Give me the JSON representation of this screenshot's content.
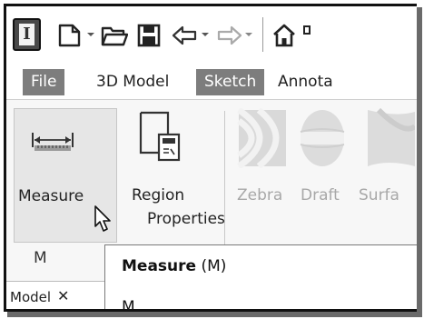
{
  "toolbar": {
    "app_letter": "I",
    "icons": [
      "new-file-icon",
      "dropdown-icon",
      "open-folder-icon",
      "save-icon",
      "undo-icon",
      "dropdown-icon",
      "redo-icon",
      "dropdown-icon",
      "home-icon"
    ]
  },
  "tabs": [
    {
      "label": "File",
      "active": true
    },
    {
      "label": "3D Model",
      "active": false
    },
    {
      "label": "Sketch",
      "active": true
    },
    {
      "label": "Annota",
      "active": false
    }
  ],
  "ribbon": {
    "measure": {
      "label": "Measure"
    },
    "region_properties": {
      "line1": "Region",
      "line2": "Properties"
    },
    "zebra": {
      "label": "Zebra"
    },
    "draft": {
      "label": "Draft"
    },
    "surface": {
      "label": "Surfa"
    },
    "panel_title": "M"
  },
  "browser": {
    "tab_label": "Model",
    "close_glyph": "✕"
  },
  "tooltip": {
    "title": "Measure",
    "shortcut": "(M)",
    "desc_fragment": "M"
  },
  "colors": {
    "tab_active_bg": "#7d7d7d",
    "ribbon_bg": "#f7f7f7",
    "highlight_bg": "#e6e6e6"
  }
}
